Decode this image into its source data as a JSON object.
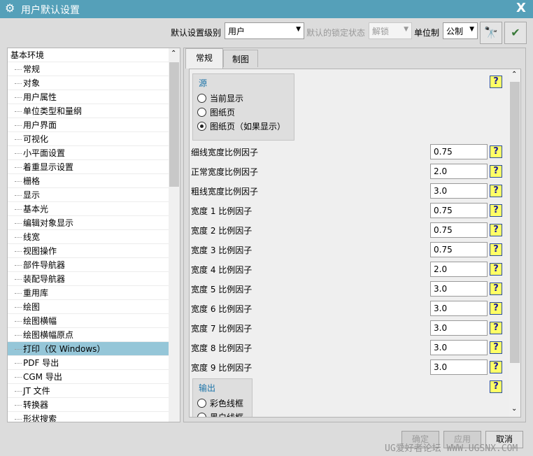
{
  "window": {
    "title": "用户默认设置",
    "close": "X"
  },
  "toolbar": {
    "level_label": "默认设置级别",
    "level_value": "用户",
    "lock_label": "默认的锁定状态",
    "lock_value": "解锁",
    "unit_label": "单位制",
    "unit_value": "公制"
  },
  "tree": {
    "root": "基本环境",
    "items": [
      "常规",
      "对象",
      "用户属性",
      "单位类型和量纲",
      "用户界面",
      "可视化",
      "小平面设置",
      "着重显示设置",
      "栅格",
      "显示",
      "基本光",
      "编辑对象显示",
      "线宽",
      "视图操作",
      "部件导航器",
      "装配导航器",
      "重用库",
      "绘图",
      "绘图横幅",
      "绘图横幅原点",
      "打印（仅 Windows）",
      "PDF 导出",
      "CGM 导出",
      "JT 文件",
      "转换器",
      "形状搜索"
    ],
    "selected_index": 20
  },
  "tabs": [
    "常规",
    "制图"
  ],
  "source": {
    "title": "源",
    "options": [
      "当前显示",
      "图纸页",
      "图纸页（如果显示）"
    ],
    "selected": 2
  },
  "fields": [
    {
      "label": "细线宽度比例因子",
      "value": "0.75"
    },
    {
      "label": "正常宽度比例因子",
      "value": "2.0"
    },
    {
      "label": "粗线宽度比例因子",
      "value": "3.0"
    },
    {
      "label": "宽度 1 比例因子",
      "value": "0.75"
    },
    {
      "label": "宽度 2 比例因子",
      "value": "0.75"
    },
    {
      "label": "宽度 3 比例因子",
      "value": "0.75"
    },
    {
      "label": "宽度 4 比例因子",
      "value": "2.0"
    },
    {
      "label": "宽度 5 比例因子",
      "value": "3.0"
    },
    {
      "label": "宽度 6 比例因子",
      "value": "3.0"
    },
    {
      "label": "宽度 7 比例因子",
      "value": "3.0"
    },
    {
      "label": "宽度 8 比例因子",
      "value": "3.0"
    },
    {
      "label": "宽度 9 比例因子",
      "value": "3.0"
    }
  ],
  "output": {
    "title": "输出",
    "options": [
      "彩色线框",
      "黑白线框"
    ]
  },
  "buttons": {
    "ok": "确定",
    "apply": "应用",
    "cancel": "取消"
  },
  "help_glyph": "?",
  "watermark": "UG爱好者论坛 WWW.UGSNX.COM"
}
